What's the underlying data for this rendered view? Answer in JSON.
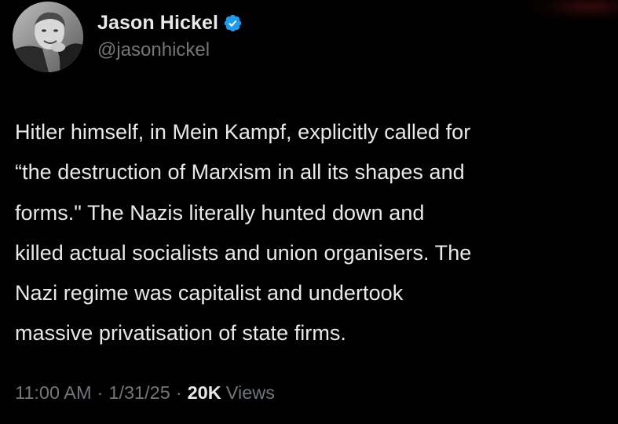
{
  "author": {
    "display_name": "Jason Hickel",
    "handle": "@jasonhickel",
    "verified": true,
    "verified_icon": "verified-badge-icon",
    "avatar_icon": "profile-photo"
  },
  "tweet": {
    "text": "Hitler himself, in Mein Kampf, explicitly called for\n“the destruction of Marxism in all its shapes and\nforms.\"  The Nazis literally hunted down and\nkilled actual socialists and union organisers. The\nNazi regime was capitalist and undertook\nmassive privatisation of state firms."
  },
  "meta": {
    "time": "11:00 AM",
    "date": "1/31/25",
    "separator": "·",
    "views_count": "20K",
    "views_label": "Views"
  },
  "colors": {
    "background": "#000000",
    "primary_text": "#e7e9ea",
    "secondary_text": "#71767b",
    "verified_blue": "#1d9bf0"
  }
}
